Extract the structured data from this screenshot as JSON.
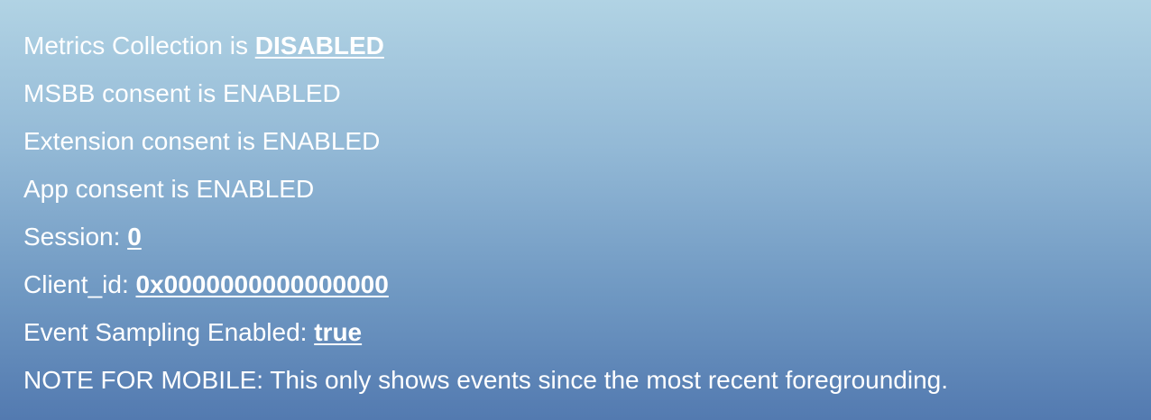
{
  "metrics": {
    "collection_label": "Metrics Collection is",
    "collection_state": "DISABLED",
    "msbb": "MSBB consent is ENABLED",
    "extension": "Extension consent is ENABLED",
    "app": "App consent is ENABLED",
    "session_label": "Session:",
    "session_value": "0",
    "client_id_label": "Client_id:",
    "client_id_value": "0x0000000000000000",
    "sampling_label": "Event Sampling Enabled:",
    "sampling_value": "true",
    "note": "NOTE FOR MOBILE: This only shows events since the most recent foregrounding."
  },
  "colors": {
    "text": "#ffffff",
    "gradient_top": "#b1d3e4",
    "gradient_bottom": "#537ab0"
  }
}
